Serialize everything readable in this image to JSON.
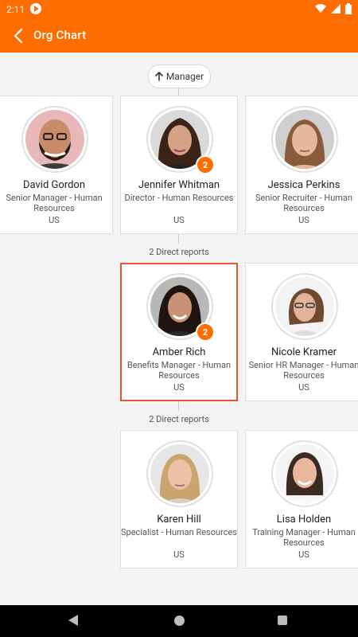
{
  "status_bar": {
    "time": "2:11"
  },
  "app_bar": {
    "title": "Org Chart"
  },
  "manager_button": {
    "label": "Manager"
  },
  "managers_row": [
    {
      "name": "David Gordon",
      "role": "Senior Manager - Human Resources",
      "location": "US",
      "badge": ""
    },
    {
      "name": "Jennifer Whitman",
      "role": "Director - Human Resources",
      "location": "US",
      "badge": "2"
    },
    {
      "name": "Jessica Perkins",
      "role": "Senior Recruiter - Human Resources",
      "location": "US",
      "badge": ""
    }
  ],
  "section_labels": {
    "first": "2 Direct reports",
    "second": "2 Direct reports"
  },
  "middle_row": [
    {
      "name": "Amber Rich",
      "role": "Benefits Manager - Human Resources",
      "location": "US",
      "badge": "2"
    },
    {
      "name": "Nicole Kramer",
      "role": "Senior HR Manager - Human Resources",
      "location": "US",
      "badge": ""
    }
  ],
  "bottom_row": [
    {
      "name": "Karen Hill",
      "role": "Specialist - Human Resources",
      "location": "US",
      "badge": ""
    },
    {
      "name": "Lisa Holden",
      "role": "Training Manager - Human Resources",
      "location": "US",
      "badge": ""
    }
  ],
  "colors": {
    "accent": "#FF6D00",
    "selected_border": "#e6543b"
  }
}
